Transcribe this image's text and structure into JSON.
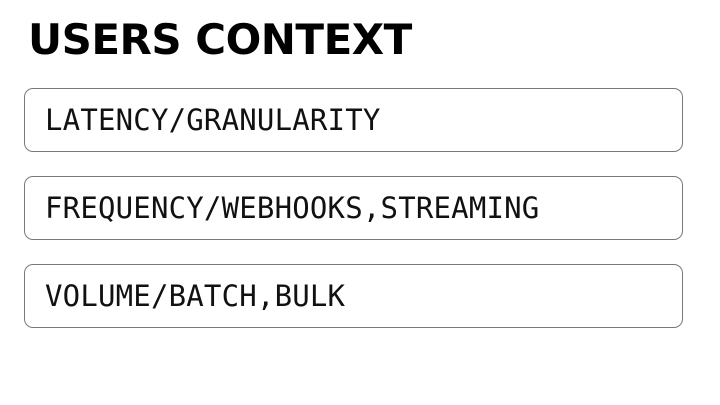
{
  "title": "USERS CONTEXT",
  "items": [
    {
      "label": "LATENCY/GRANULARITY"
    },
    {
      "label": "FREQUENCY/WEBHOOKS,STREAMING"
    },
    {
      "label": "VOLUME/BATCH,BULK"
    }
  ],
  "colors": {
    "text": "#000000",
    "box_border": "#7a7a7a",
    "background": "#ffffff"
  }
}
